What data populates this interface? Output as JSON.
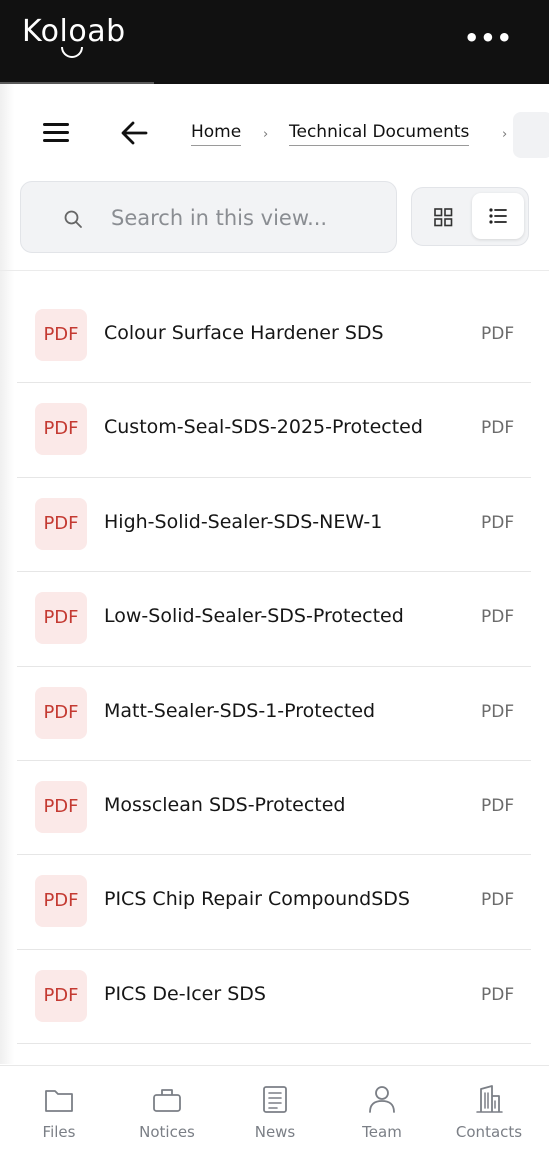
{
  "app": {
    "logo": "Koloab"
  },
  "breadcrumb": {
    "items": [
      {
        "label": "Home"
      },
      {
        "label": "Technical Documents"
      }
    ],
    "separator": "›"
  },
  "search": {
    "placeholder": "Search in this view..."
  },
  "view_toggle": {
    "selected": "list",
    "options": [
      "grid-icon",
      "list-icon"
    ]
  },
  "files": [
    {
      "badge": "PDF",
      "name": "Colour Surface Hardener SDS",
      "type": "PDF"
    },
    {
      "badge": "PDF",
      "name": "Custom-Seal-SDS-2025-Protected",
      "type": "PDF"
    },
    {
      "badge": "PDF",
      "name": "High-Solid-Sealer-SDS-NEW-1",
      "type": "PDF"
    },
    {
      "badge": "PDF",
      "name": "Low-Solid-Sealer-SDS-Protected",
      "type": "PDF"
    },
    {
      "badge": "PDF",
      "name": "Matt-Sealer-SDS-1-Protected",
      "type": "PDF"
    },
    {
      "badge": "PDF",
      "name": "Mossclean SDS-Protected",
      "type": "PDF"
    },
    {
      "badge": "PDF",
      "name": "PICS Chip Repair CompoundSDS",
      "type": "PDF"
    },
    {
      "badge": "PDF",
      "name": "PICS De-Icer SDS",
      "type": "PDF"
    }
  ],
  "bottom_nav": [
    {
      "label": "Files",
      "icon": "folder-icon"
    },
    {
      "label": "Notices",
      "icon": "briefcase-icon"
    },
    {
      "label": "News",
      "icon": "newspaper-icon"
    },
    {
      "label": "Team",
      "icon": "person-icon"
    },
    {
      "label": "Contacts",
      "icon": "building-icon"
    }
  ],
  "colors": {
    "topbar": "#111111",
    "pdf_badge_bg": "#fbe9e8",
    "pdf_badge_text": "#c43a32",
    "nav_label": "#7b7f86"
  }
}
